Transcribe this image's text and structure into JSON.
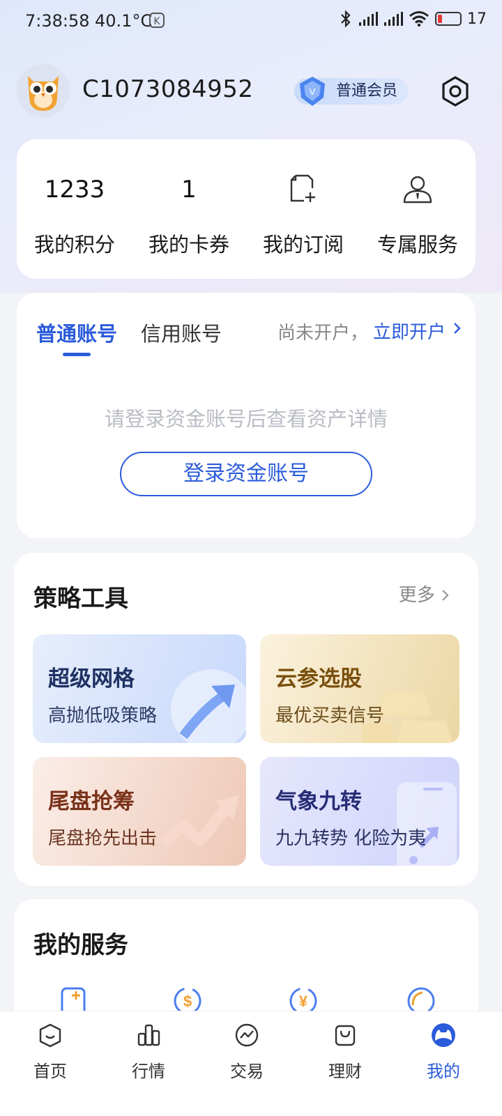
{
  "status_bar": {
    "time": "7:38:58",
    "temperature": "40.1°C",
    "battery": "17"
  },
  "profile": {
    "username": "C1073084952",
    "member_level": "普通会员"
  },
  "stats": [
    {
      "value": "1233",
      "label": "我的积分"
    },
    {
      "value": "1",
      "label": "我的卡券"
    },
    {
      "icon": "subscription-icon",
      "label": "我的订阅"
    },
    {
      "icon": "advisor-icon",
      "label": "专属服务"
    }
  ],
  "account": {
    "tab_normal": "普通账号",
    "tab_credit": "信用账号",
    "not_opened": "尚未开户，",
    "open_link": "立即开户",
    "login_hint": "请登录资金账号后查看资产详情",
    "login_button": "登录资金账号"
  },
  "strategy": {
    "title": "策略工具",
    "more": "更多",
    "tiles": [
      {
        "title": "超级网格",
        "subtitle": "高抛低吸策略"
      },
      {
        "title": "云参选股",
        "subtitle": "最优买卖信号"
      },
      {
        "title": "尾盘抢筹",
        "subtitle": "尾盘抢先出击"
      },
      {
        "title": "气象九转",
        "subtitle": "九九转势 化险为夷"
      }
    ]
  },
  "services": {
    "title": "我的服务"
  },
  "nav": [
    {
      "label": "首页",
      "icon": "home-icon"
    },
    {
      "label": "行情",
      "icon": "market-icon"
    },
    {
      "label": "交易",
      "icon": "trade-icon"
    },
    {
      "label": "理财",
      "icon": "wealth-icon"
    },
    {
      "label": "我的",
      "icon": "profile-icon",
      "active": true
    }
  ],
  "colors": {
    "accent": "#2a5bdb",
    "background": "#f3f4f7"
  }
}
